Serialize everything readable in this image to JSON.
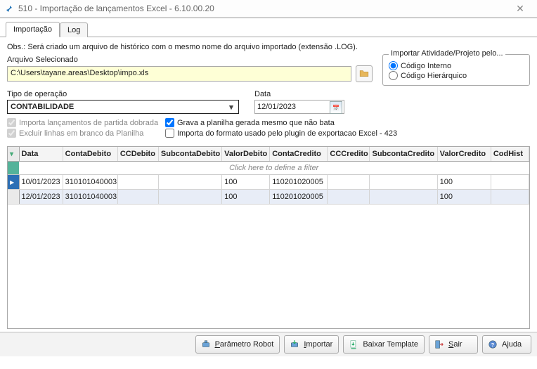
{
  "window": {
    "title": "510 - Importação de lançamentos Excel - 6.10.00.20"
  },
  "tabs": {
    "import": "Importação",
    "log": "Log"
  },
  "obs": "Obs.: Será criado um arquivo de histórico com o mesmo nome do arquivo importado (extensão .LOG).",
  "file": {
    "label": "Arquivo Selecionado",
    "path": "C:\\Users\\tayane.areas\\Desktop\\impo.xls"
  },
  "importBy": {
    "title": "Importar Atividade/Projeto pelo...",
    "opt_internal": "Código Interno",
    "opt_hier": "Código Hierárquico"
  },
  "op": {
    "label": "Tipo de operação",
    "value": "CONTABILIDADE"
  },
  "date": {
    "label": "Data",
    "value": "12/01/2023"
  },
  "checks": {
    "partida": "Importa lançamentos de partida dobrada",
    "excluir": "Excluir linhas em branco da Planilha",
    "grava": "Grava a planilha gerada mesmo que não bata",
    "formato423": "Importa do formato usado pelo plugin de exportacao Excel - 423"
  },
  "grid": {
    "filter_hint": "Click here to define a filter",
    "headers": {
      "data": "Data",
      "contaDebito": "ContaDebito",
      "ccDebito": "CCDebito",
      "subDebito": "SubcontaDebito",
      "valorDebito": "ValorDebito",
      "contaCredito": "ContaCredito",
      "ccCredito": "CCCredito",
      "subCredito": "SubcontaCredito",
      "valorCredito": "ValorCredito",
      "codHist": "CodHist"
    },
    "rows": [
      {
        "data": "10/01/2023",
        "contaDebito": "310101040003",
        "ccDebito": "",
        "subDebito": "",
        "valorDebito": "100",
        "contaCredito": "110201020005",
        "ccCredito": "",
        "subCredito": "",
        "valorCredito": "100",
        "codHist": ""
      },
      {
        "data": "12/01/2023",
        "contaDebito": "310101040003",
        "ccDebito": "",
        "subDebito": "",
        "valorDebito": "100",
        "contaCredito": "110201020005",
        "ccCredito": "",
        "subCredito": "",
        "valorCredito": "100",
        "codHist": ""
      }
    ]
  },
  "buttons": {
    "robot": "Parâmetro Robot",
    "import": "Importar",
    "template": "Baixar Template",
    "exit": "Sair",
    "help": "Ajuda"
  }
}
